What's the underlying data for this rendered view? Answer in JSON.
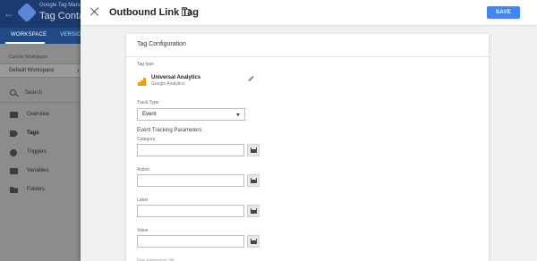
{
  "app": {
    "back_icon": "arrow-left-icon",
    "brand": "Google Tag Manager",
    "container_name": "Tag Container",
    "tabs": [
      {
        "label": "WORKSPACE",
        "active": true
      },
      {
        "label": "VERSIONS",
        "active": false
      }
    ],
    "accent_color": "#1b3b6f"
  },
  "sidebar": {
    "current_workspace_label": "Current Workspace",
    "current_workspace_value": "Default Workspace",
    "search_label": "Search",
    "items": [
      {
        "label": "Overview",
        "icon": "overview-icon",
        "active": false
      },
      {
        "label": "Tags",
        "icon": "tag-icon",
        "active": true
      },
      {
        "label": "Triggers",
        "icon": "trigger-icon",
        "active": false
      },
      {
        "label": "Variables",
        "icon": "variables-icon",
        "active": false
      },
      {
        "label": "Folders",
        "icon": "folder-icon",
        "active": false
      }
    ]
  },
  "panel": {
    "title": "Outbound Link Tag",
    "save_label": "SAVE",
    "save_color": "#4285f4",
    "card_title": "Tag Configuration",
    "tag_type_label": "Tag type",
    "tag_type_name": "Universal Analytics",
    "tag_type_sub": "Google Analytics",
    "track_type_label": "Track Type",
    "track_type_value": "Event",
    "section_title": "Event Tracking Parameters",
    "fields": [
      {
        "label": "Category",
        "value": ""
      },
      {
        "label": "Action",
        "value": ""
      },
      {
        "label": "Label",
        "value": ""
      },
      {
        "label": "Value",
        "value": ""
      }
    ],
    "next_field_label": "Non-Interaction Hit"
  }
}
